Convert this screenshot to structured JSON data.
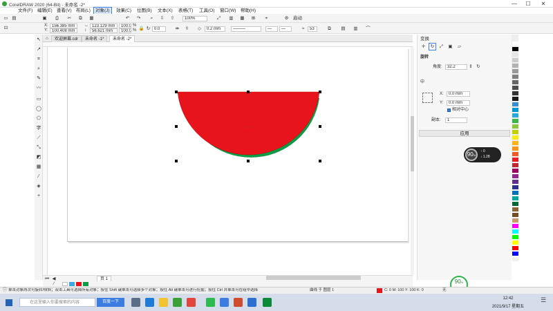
{
  "titlebar": {
    "title": "CorelDRAW 2020 (64-Bit) - 未命名 -2*"
  },
  "menu": {
    "items": [
      "文件(F)",
      "编辑(E)",
      "查看(V)",
      "布局(L)",
      "对象(J)",
      "效果(C)",
      "位图(B)",
      "文本(X)",
      "表格(T)",
      "工具(O)",
      "窗口(W)",
      "帮助(H)"
    ],
    "active_index": 4
  },
  "standard_toolbar": {
    "zoom": "100%",
    "launch": "启动"
  },
  "property_bar": {
    "x": "156.385 mm",
    "y": "100.408 mm",
    "w": "123.129 mm",
    "h": "56.621 mm",
    "scale_w": "100.0",
    "scale_h": "100.0",
    "pct": "%",
    "rotation": "0.0",
    "outline": "0.2 mm",
    "nodes": "53"
  },
  "doc_tabs": [
    "欢迎屏幕.cdr",
    "未命名 -1*",
    "未命名 -2*"
  ],
  "doc_tabs_active": 2,
  "docker": {
    "title": "变换",
    "section": "旋转",
    "angle_label": "角度:",
    "angle": "32.2",
    "center_label": "中",
    "x_label": "X:",
    "x": "0.0 mm",
    "y_label": "Y:",
    "y": "0.0 mm",
    "relative": "相对中心",
    "copies_label": "副本:",
    "copies": "1",
    "apply": "应用"
  },
  "overlay_speed": {
    "value": "90",
    "unit": "%",
    "up": "0",
    "down": "1.28"
  },
  "pagebar": {
    "page": "页 1"
  },
  "status": {
    "hint": "单击对象两次可旋转/倾斜；双击工具可选择所有对象；按住 Shift 键单击可选择多个对象；按住 Alt 键单击可进行挖掘；按住 Ctrl 并单击可在组中选择",
    "layer": "曲线 于 图层 1",
    "fill_c": "C: 0 M: 100 Y: 100 K: 0",
    "outline": "无"
  },
  "taskbar": {
    "search": "在这里输入你要搜索的内容",
    "hot": "百度一下",
    "time": "12:42",
    "date": "2021/9/17 星期五"
  },
  "colors": {
    "red": "#e8141c",
    "green": "#0f9a46",
    "accent": "#3b7de0"
  },
  "palette": [
    "#ffffff",
    "#000000",
    "#e6e6e6",
    "#cccccc",
    "#b3b3b3",
    "#999999",
    "#808080",
    "#666666",
    "#4d4d4d",
    "#333333",
    "#1a1a1a",
    "#3a8ccf",
    "#0096d6",
    "#29a8e0",
    "#39b54a",
    "#8dc63f",
    "#c2d000",
    "#f7ec13",
    "#fcb515",
    "#f7941d",
    "#f15a24",
    "#ed1c24",
    "#c1272d",
    "#9e005d",
    "#92278f",
    "#662d91",
    "#2e3192",
    "#0071bc",
    "#00a99d",
    "#006837",
    "#8c6239",
    "#754c24",
    "#c69c6d",
    "#ff00ff",
    "#00ffff",
    "#00ff00",
    "#ffff00",
    "#ff0000",
    "#0000ff",
    "#f0f0f0"
  ]
}
